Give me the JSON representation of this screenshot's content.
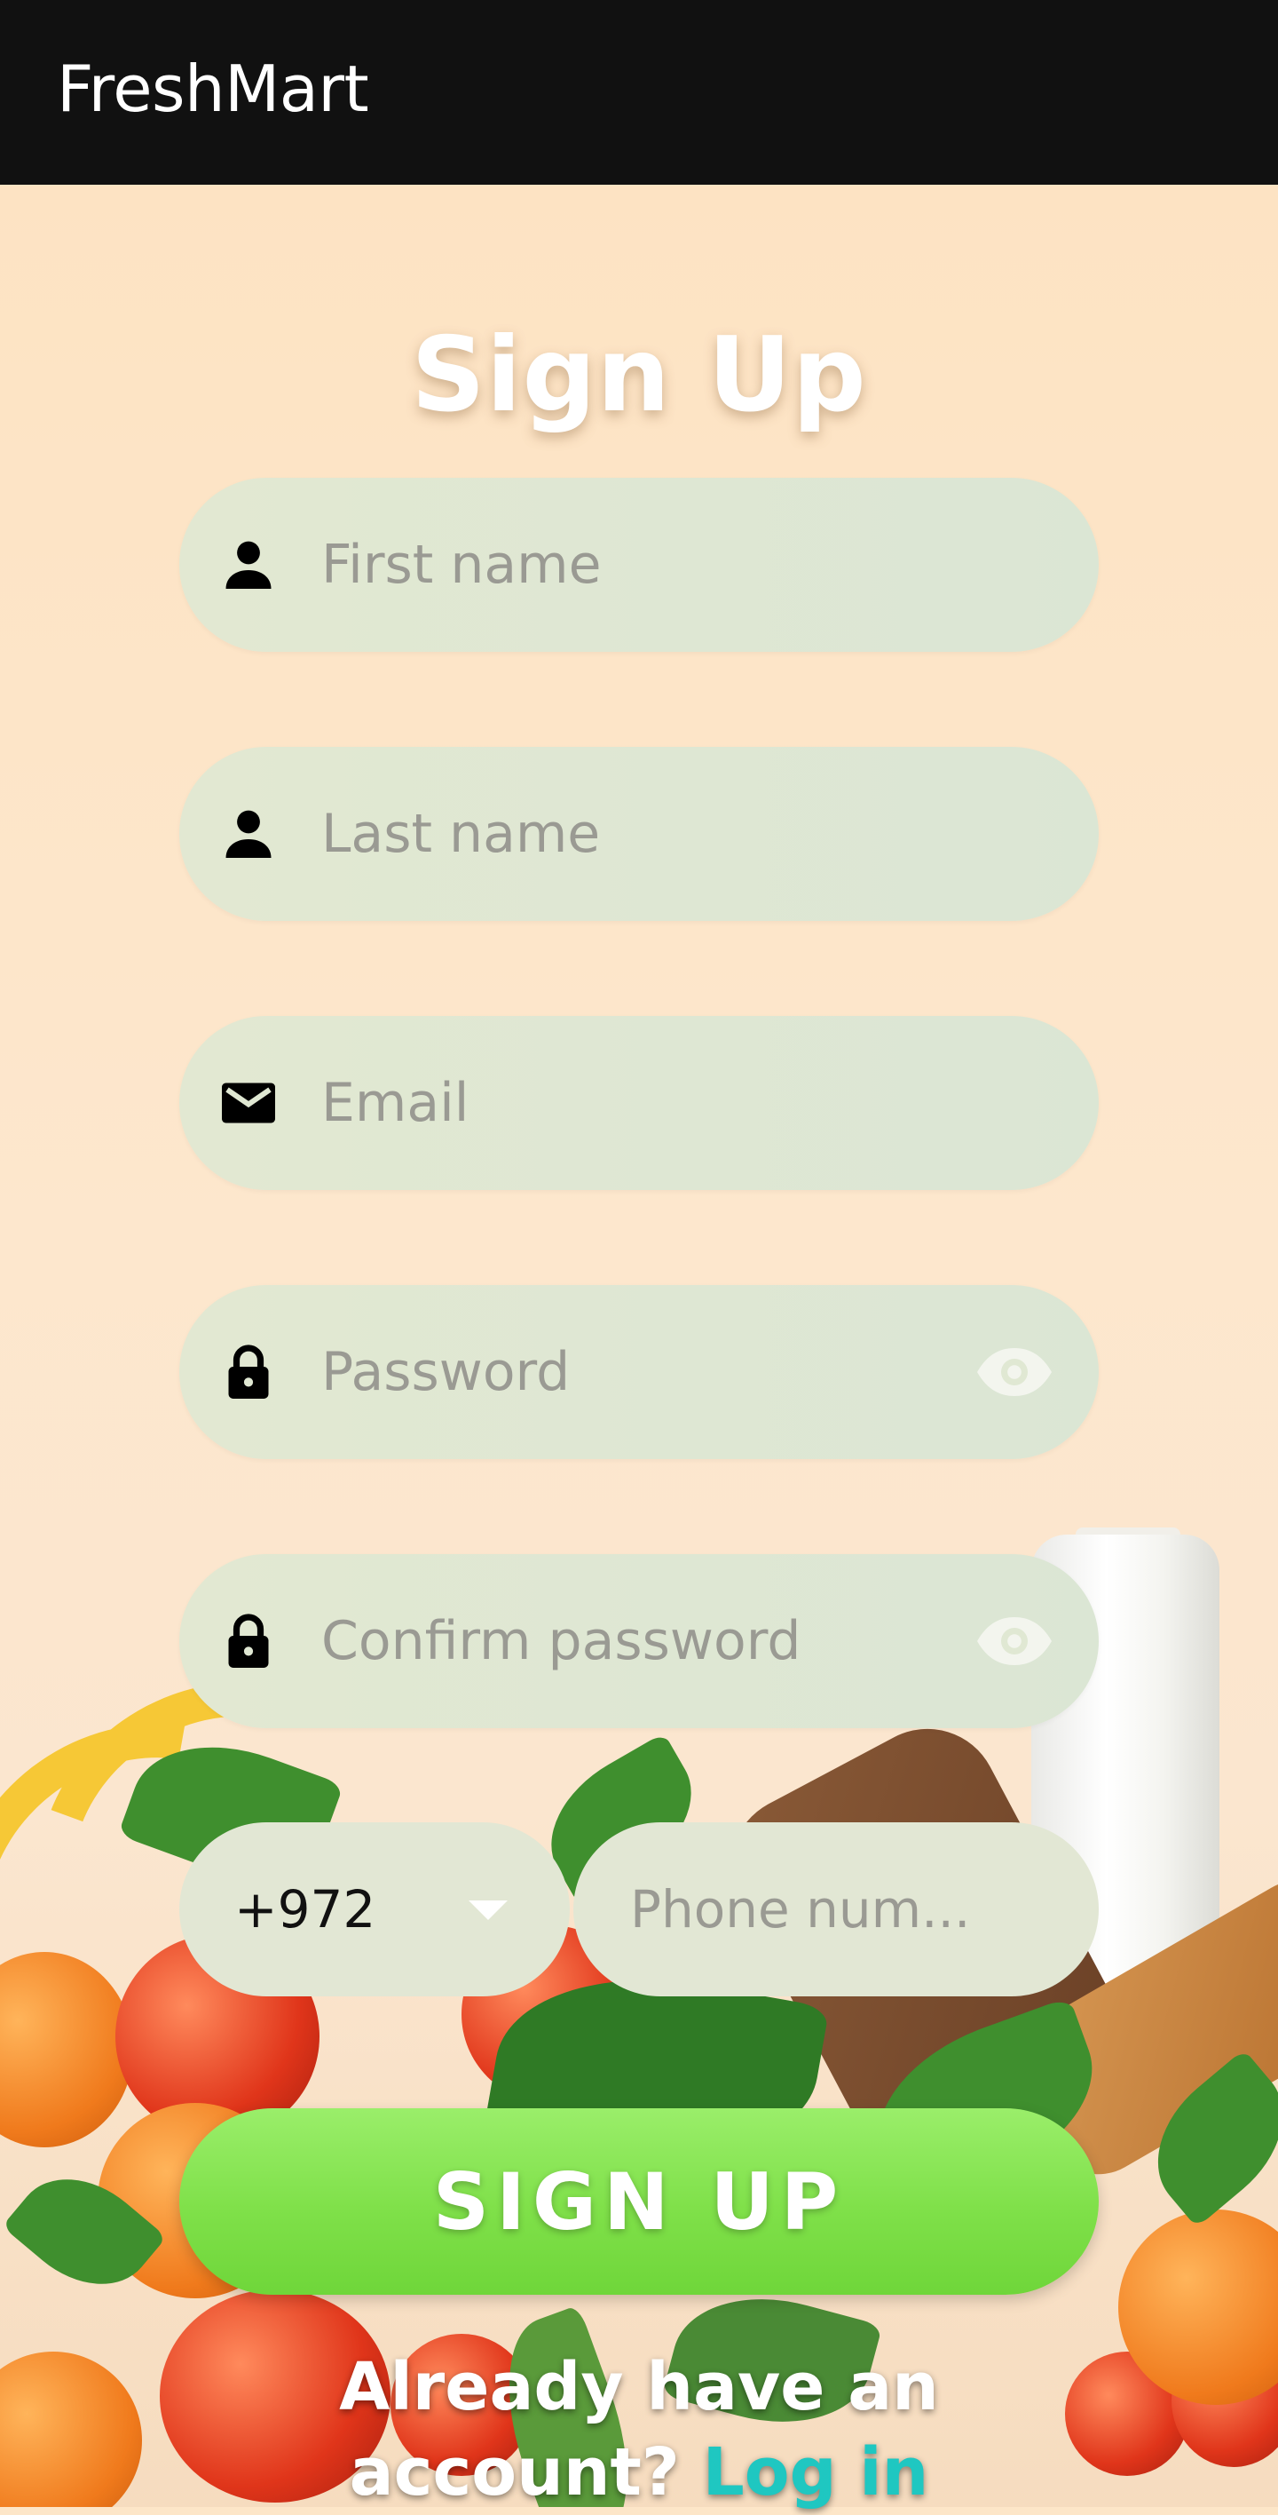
{
  "appbar": {
    "title": "FreshMart"
  },
  "page": {
    "heading": "Sign Up"
  },
  "form": {
    "first_name": {
      "placeholder": "First name",
      "icon": "person-icon"
    },
    "last_name": {
      "placeholder": "Last name",
      "icon": "person-icon"
    },
    "email": {
      "placeholder": "Email",
      "icon": "mail-icon"
    },
    "password": {
      "placeholder": "Password",
      "icon": "lock-icon",
      "toggle_icon": "eye-icon"
    },
    "confirm_password": {
      "placeholder": "Confirm password",
      "icon": "lock-icon",
      "toggle_icon": "eye-icon"
    },
    "country_code": {
      "value": "+972",
      "icon": "caret-down-icon"
    },
    "phone": {
      "placeholder": "Phone num..."
    },
    "submit_label": "SIGN UP"
  },
  "footer": {
    "prompt_line1": "Already have an",
    "prompt_line2": "account?",
    "login_label": "Log in"
  },
  "colors": {
    "appbar": "#111111",
    "field_bg": "#e0e8d3",
    "button": "#7fe049",
    "link": "#1fc7c1",
    "background": "#fde6c8"
  }
}
